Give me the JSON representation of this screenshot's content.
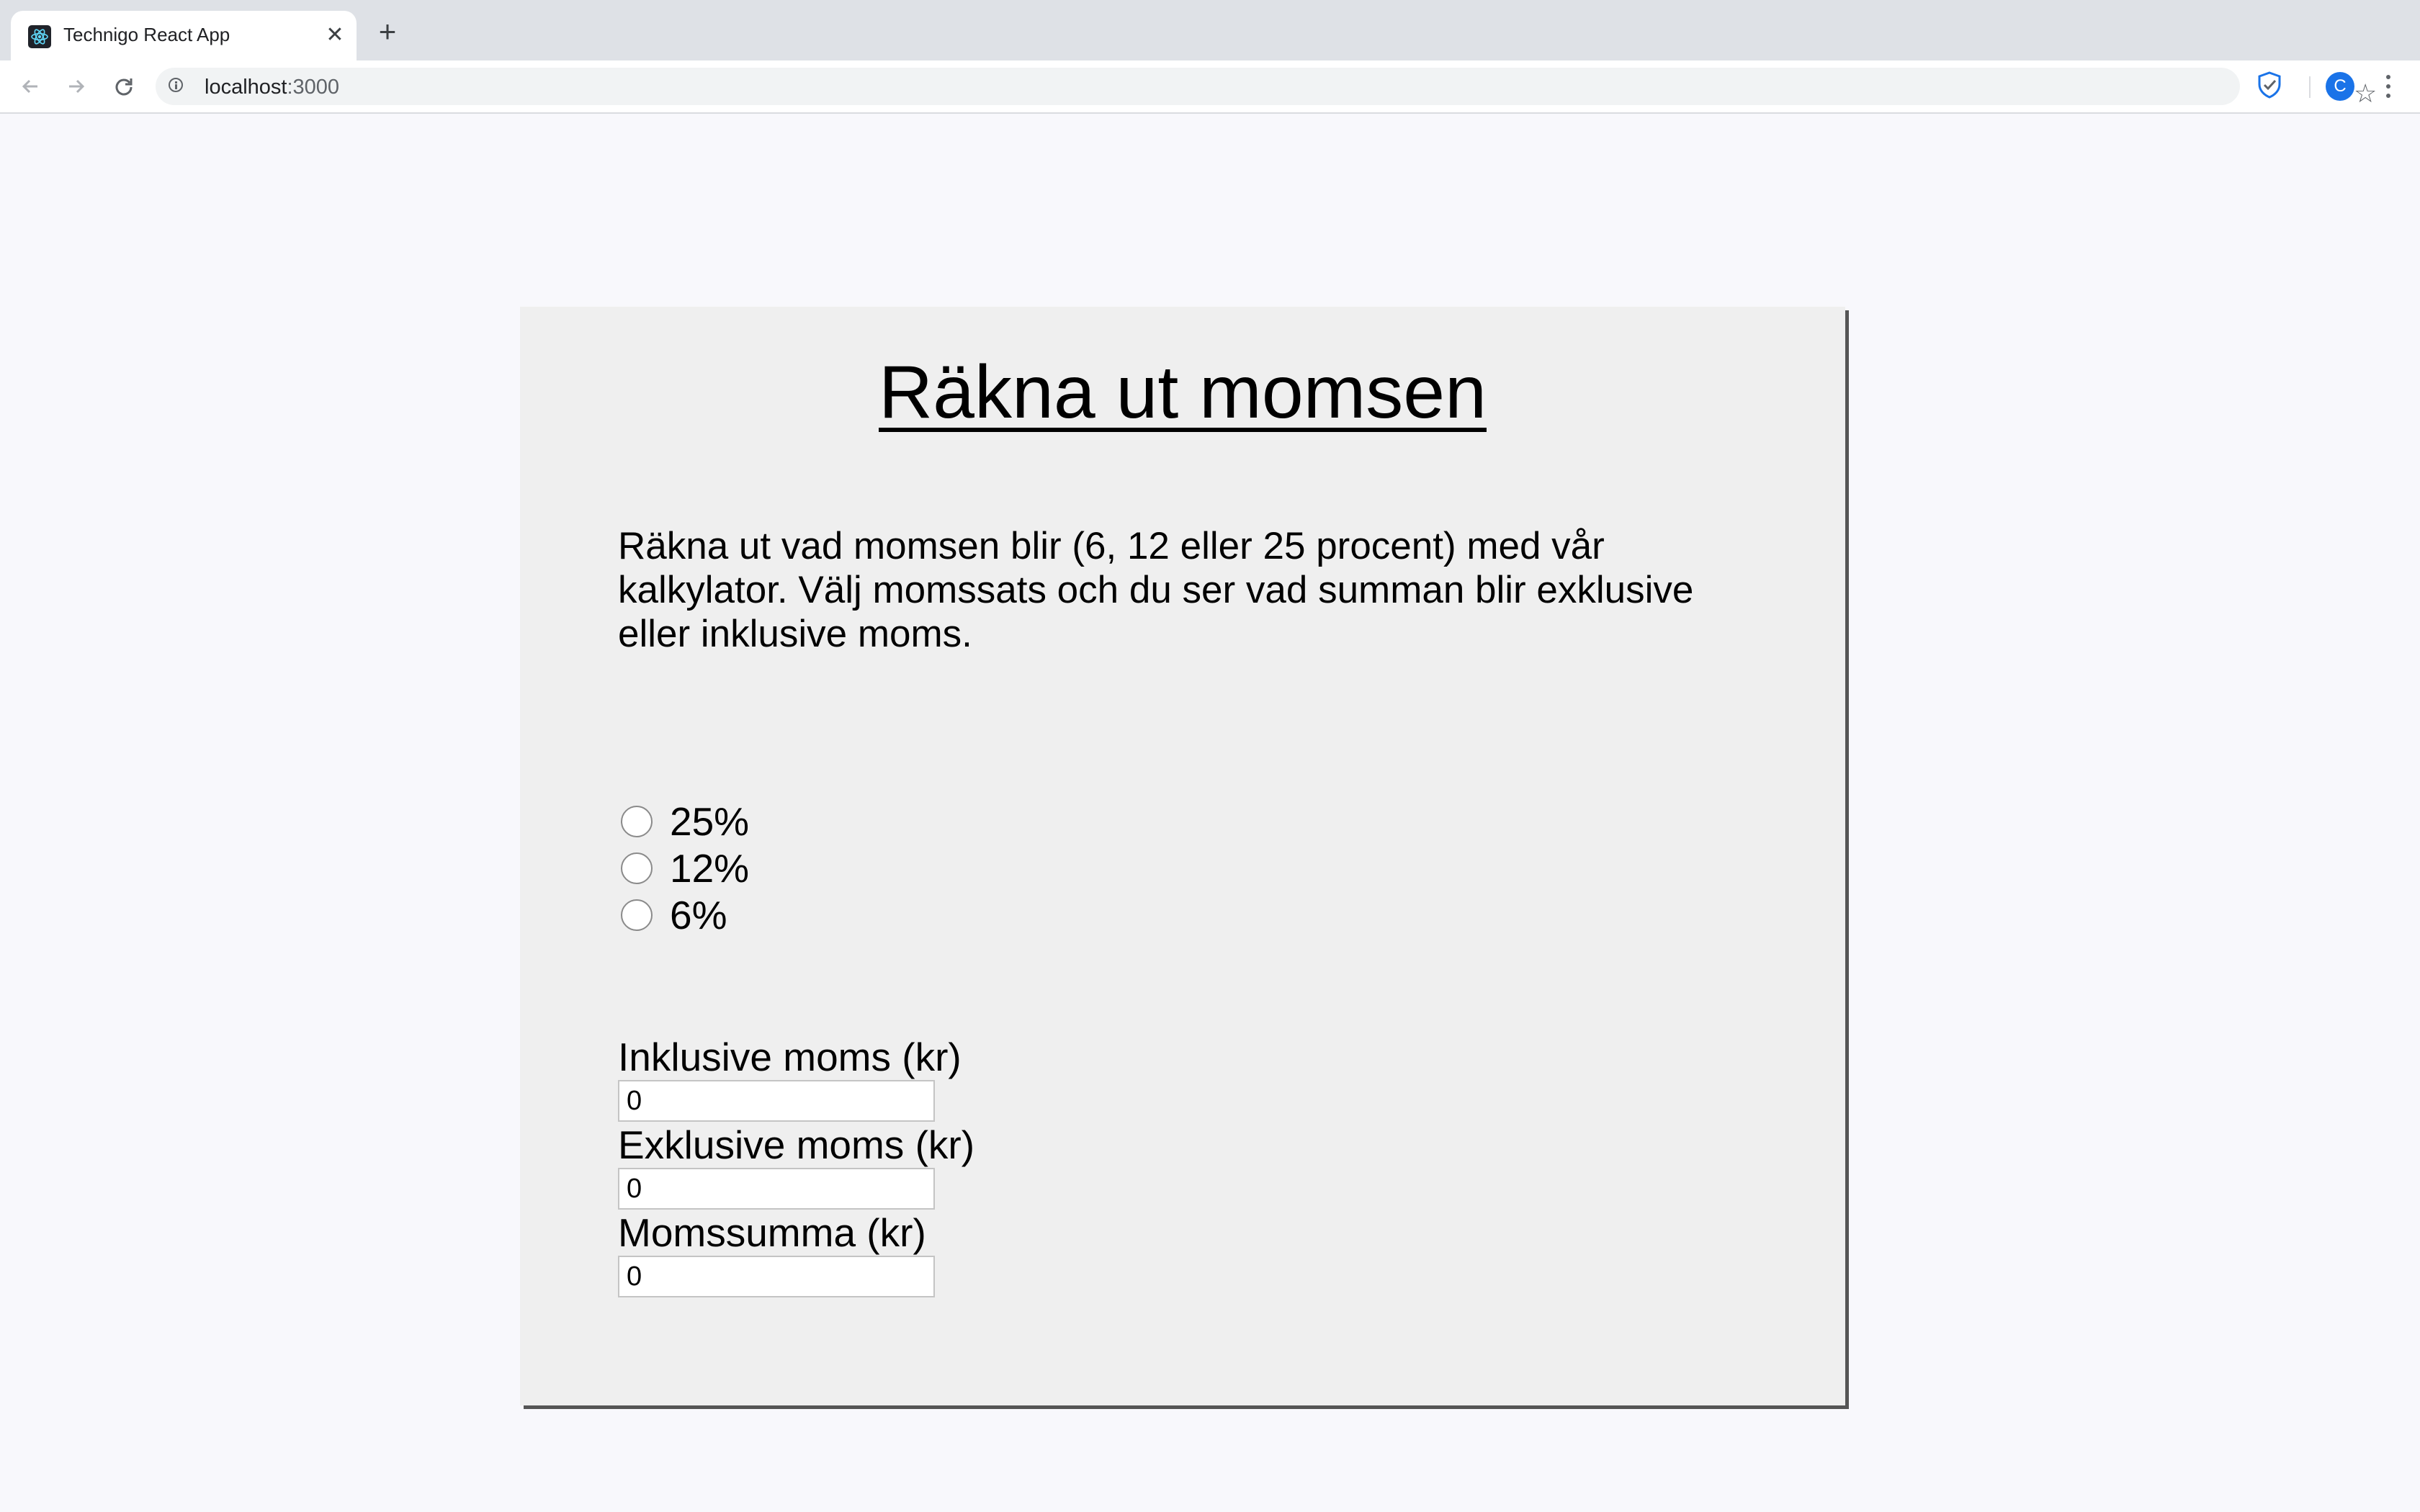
{
  "browser": {
    "tab_title": "Technigo React App",
    "url_host": "localhost",
    "url_port": ":3000",
    "profile_initial": "C"
  },
  "page": {
    "title": "Räkna ut momsen",
    "description": "Räkna ut vad momsen blir (6, 12 eller 25 procent) med vår kalkylator. Välj momssats och du ser vad summan blir exklusive eller inklusive moms.",
    "rates": [
      {
        "label": "25%",
        "selected": false
      },
      {
        "label": "12%",
        "selected": false
      },
      {
        "label": "6%",
        "selected": false
      }
    ],
    "fields": [
      {
        "label": "Inklusive moms (kr)",
        "value": "0"
      },
      {
        "label": "Exklusive moms (kr)",
        "value": "0"
      },
      {
        "label": "Momssumma (kr)",
        "value": "0"
      }
    ]
  },
  "colors": {
    "page_background": "#f8f8fc",
    "card_background": "#efefef",
    "card_shadow": "#555555"
  }
}
